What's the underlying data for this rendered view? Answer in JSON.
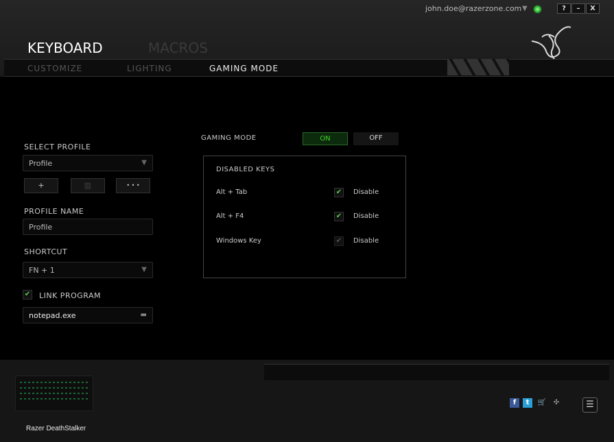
{
  "account": {
    "email": "john.doe@razerzone.com",
    "status_color": "#33cc33"
  },
  "window": {
    "help": "?",
    "minimize": "–",
    "close": "X"
  },
  "main_tabs": [
    {
      "label": "KEYBOARD",
      "active": true
    },
    {
      "label": "MACROS",
      "active": false
    }
  ],
  "sub_tabs": [
    {
      "label": "CUSTOMIZE",
      "active": false
    },
    {
      "label": "LIGHTING",
      "active": false
    },
    {
      "label": "GAMING MODE",
      "active": true
    }
  ],
  "profile": {
    "select_label": "SELECT PROFILE",
    "selected": "Profile",
    "add": "+",
    "delete_icon": "trash-icon",
    "more": "• • •",
    "name_label": "PROFILE NAME",
    "name_value": "Profile",
    "shortcut_label": "SHORTCUT",
    "shortcut_value": "FN + 1",
    "link_label": "LINK PROGRAM",
    "link_checked": true,
    "program": "notepad.exe"
  },
  "gaming_mode": {
    "label": "GAMING MODE",
    "on": "ON",
    "off": "OFF",
    "state": "ON",
    "accent": "#44d62c",
    "disabled_keys_title": "DISABLED KEYS",
    "keys": [
      {
        "name": "Alt + Tab",
        "action": "Disable",
        "checked": true,
        "enabled": true
      },
      {
        "name": "Alt + F4",
        "action": "Disable",
        "checked": true,
        "enabled": true
      },
      {
        "name": "Windows Key",
        "action": "Disable",
        "checked": true,
        "enabled": false
      }
    ]
  },
  "device": {
    "name": "Razer DeathStalker"
  },
  "footer": {
    "icons": [
      "facebook-icon",
      "twitter-icon",
      "cart-icon",
      "razer-icon"
    ],
    "menu": "☰"
  }
}
